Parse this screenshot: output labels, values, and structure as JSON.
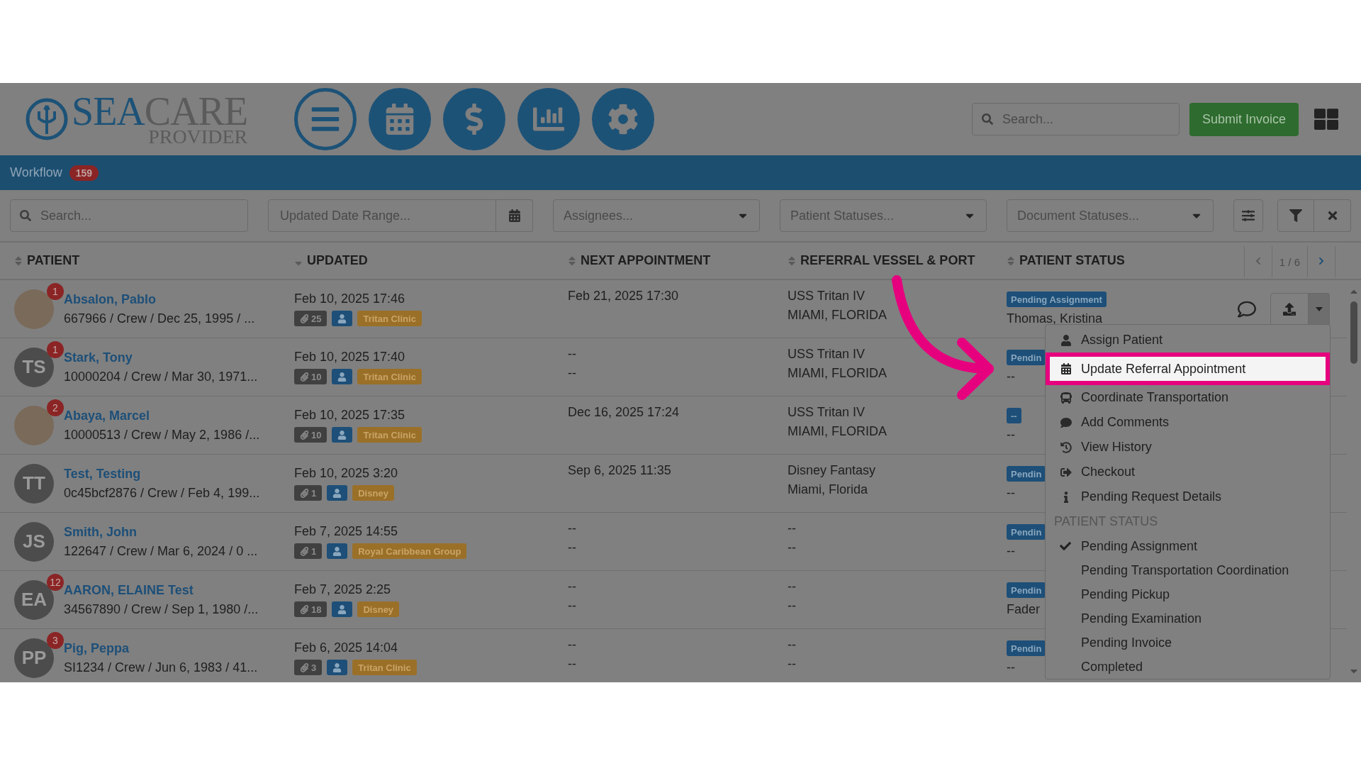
{
  "header": {
    "logo": {
      "brand_first": "SEA",
      "brand_second": "CARE",
      "subtitle": "PROVIDER"
    },
    "search": {
      "placeholder": "Search..."
    },
    "submit_button": "Submit Invoice"
  },
  "nav": {
    "title": "Workflow",
    "count": "159"
  },
  "filters": {
    "search": {
      "placeholder": "Search..."
    },
    "date_range": {
      "placeholder": "Updated Date Range..."
    },
    "assignees": {
      "placeholder": "Assignees..."
    },
    "patient_statuses": {
      "placeholder": "Patient Statuses..."
    },
    "document_statuses": {
      "placeholder": "Document Statuses..."
    }
  },
  "table": {
    "columns": [
      {
        "label": "PATIENT",
        "sorted": false
      },
      {
        "label": "UPDATED",
        "sorted": true
      },
      {
        "label": "NEXT APPOINTMENT",
        "sorted": false
      },
      {
        "label": "REFERRAL VESSEL & PORT",
        "sorted": false
      },
      {
        "label": "PATIENT STATUS",
        "sorted": false
      }
    ],
    "pager": "1 / 6",
    "rows": [
      {
        "avatar": {
          "kind": "photo",
          "alerts": "1"
        },
        "name": "Absalon, Pablo",
        "details": "667966 / Crew / Dec 25, 1995 / ...",
        "updated": "Feb 10, 2025 17:46",
        "attachments": "25",
        "clinic": "Tritan Clinic",
        "next_appointment": [
          "Feb 21, 2025 17:30"
        ],
        "vessel": [
          "USS Tritan IV",
          "MIAMI, FLORIDA"
        ],
        "status": "Pending Assignment",
        "assignee": "Thomas, Kristina",
        "actions": true
      },
      {
        "avatar": {
          "kind": "initials",
          "initials": "TS",
          "alerts": "1"
        },
        "name": "Stark, Tony",
        "details": "10000204 / Crew / Mar 30, 1971...",
        "updated": "Feb 10, 2025 17:40",
        "attachments": "10",
        "clinic": "Tritan Clinic",
        "next_appointment": [
          "--",
          "--"
        ],
        "vessel": [
          "USS Tritan IV",
          "MIAMI, FLORIDA"
        ],
        "status": "Pendin",
        "assignee": "--",
        "actions": false
      },
      {
        "avatar": {
          "kind": "photo",
          "alerts": "2"
        },
        "name": "Abaya, Marcel",
        "details": "10000513 / Crew / May 2, 1986 /...",
        "updated": "Feb 10, 2025 17:35",
        "attachments": "10",
        "clinic": "Tritan Clinic",
        "next_appointment": [
          "Dec 16, 2025 17:24"
        ],
        "vessel": [
          "USS Tritan IV",
          "MIAMI, FLORIDA"
        ],
        "status": "--",
        "assignee": "--",
        "actions": false
      },
      {
        "avatar": {
          "kind": "initials",
          "initials": "TT"
        },
        "name": "Test, Testing",
        "details": "0c45bcf2876 / Crew / Feb 4, 199...",
        "updated": "Feb 10, 2025 3:20",
        "attachments": "1",
        "clinic": "Disney",
        "next_appointment": [
          "Sep 6, 2025 11:35"
        ],
        "vessel": [
          "Disney Fantasy",
          "Miami, Florida"
        ],
        "status": "Pendin",
        "assignee": "--",
        "actions": false
      },
      {
        "avatar": {
          "kind": "initials",
          "initials": "JS"
        },
        "name": "Smith, John",
        "details": "122647 / Crew / Mar 6, 2024 / 0 ...",
        "updated": "Feb 7, 2025 14:55",
        "attachments": "1",
        "clinic": "Royal Caribbean Group",
        "next_appointment": [
          "--",
          "--"
        ],
        "vessel": [
          "--",
          "--"
        ],
        "status": "Pendin",
        "assignee": "--",
        "actions": false
      },
      {
        "avatar": {
          "kind": "initials",
          "initials": "EA",
          "alerts": "12"
        },
        "name": "AARON, ELAINE Test",
        "details": "34567890 / Crew / Sep 1, 1980 /...",
        "updated": "Feb 7, 2025 2:25",
        "attachments": "18",
        "clinic": "Disney",
        "next_appointment": [
          "--",
          "--"
        ],
        "vessel": [
          "--",
          "--"
        ],
        "status": "Pendin",
        "assignee": "Fader",
        "actions": false
      },
      {
        "avatar": {
          "kind": "initials",
          "initials": "PP",
          "alerts": "3"
        },
        "name": "Pig, Peppa",
        "details": "SI1234 / Crew / Jun 6, 1983 / 41...",
        "updated": "Feb 6, 2025 14:04",
        "attachments": "3",
        "clinic": "Tritan Clinic",
        "next_appointment": [
          "--",
          "--"
        ],
        "vessel": [
          "--",
          "--"
        ],
        "status": "Pendin",
        "assignee": "--",
        "actions": false
      }
    ]
  },
  "menu": {
    "actions": [
      {
        "label": "Assign Patient",
        "selected": false
      },
      {
        "label": "Update Referral Appointment",
        "selected": true
      },
      {
        "label": "Coordinate Transportation",
        "selected": false
      },
      {
        "label": "Add Comments",
        "selected": false
      },
      {
        "label": "View History",
        "selected": false
      },
      {
        "label": "Checkout",
        "selected": false
      },
      {
        "label": "Pending Request Details",
        "selected": false
      }
    ],
    "section": "PATIENT STATUS",
    "statuses": [
      {
        "label": "Pending Assignment",
        "checked": true
      },
      {
        "label": "Pending Transportation Coordination",
        "checked": false
      },
      {
        "label": "Pending Pickup",
        "checked": false
      },
      {
        "label": "Pending Examination",
        "checked": false
      },
      {
        "label": "Pending Invoice",
        "checked": false
      },
      {
        "label": "Completed",
        "checked": false
      }
    ]
  }
}
